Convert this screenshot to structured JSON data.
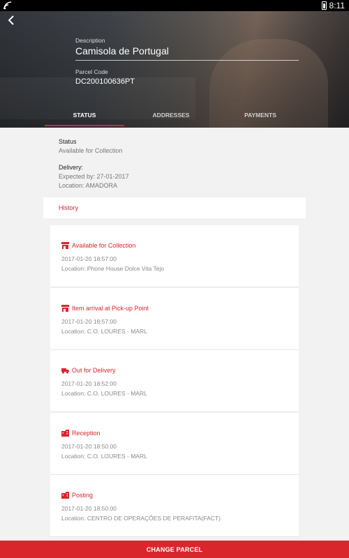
{
  "status_bar": {
    "time": "8:11"
  },
  "header": {
    "description_label": "Description",
    "description_value": "Camisola de Portugal",
    "parcel_code_label": "Parcel Code",
    "parcel_code_value": "DC200100636PT"
  },
  "tabs": [
    {
      "label": "STATUS",
      "active": true
    },
    {
      "label": "ADDRESSES",
      "active": false
    },
    {
      "label": "PAYMENTS",
      "active": false
    }
  ],
  "status": {
    "heading": "Status",
    "value": "Available for Collection"
  },
  "delivery": {
    "heading": "Delivery:",
    "expected": "Expected by: 27-01-2017",
    "location": "Location: AMADORA"
  },
  "history_label": "History",
  "history": [
    {
      "icon": "store-icon",
      "title": "Available for Collection",
      "date": "2017-01-20 18:57:00",
      "location": "Location: Phone House Dolce Vita Tejo"
    },
    {
      "icon": "store-icon",
      "title": "Item arrival at Pick-up Point",
      "date": "2017-01-20 18:57:00",
      "location": "Location: C.O. LOURES - MARL"
    },
    {
      "icon": "truck-icon",
      "title": "Out for Delivery",
      "date": "2017-01-20 18:52:00",
      "location": "Location: C.O. LOURES - MARL"
    },
    {
      "icon": "building-icon",
      "title": "Reception",
      "date": "2017-01-20 18:50:00",
      "location": "Location: C.O. LOURES - MARL"
    },
    {
      "icon": "building-icon",
      "title": "Posting",
      "date": "2017-01-20 18:50:00",
      "location": "Location: CENTRO DE OPERAÇÕES DE PERAFITA(FACT)"
    }
  ],
  "bottom_button": "CHANGE PARCEL",
  "colors": {
    "accent": "#d9262c",
    "background": "#f2f2f2"
  }
}
